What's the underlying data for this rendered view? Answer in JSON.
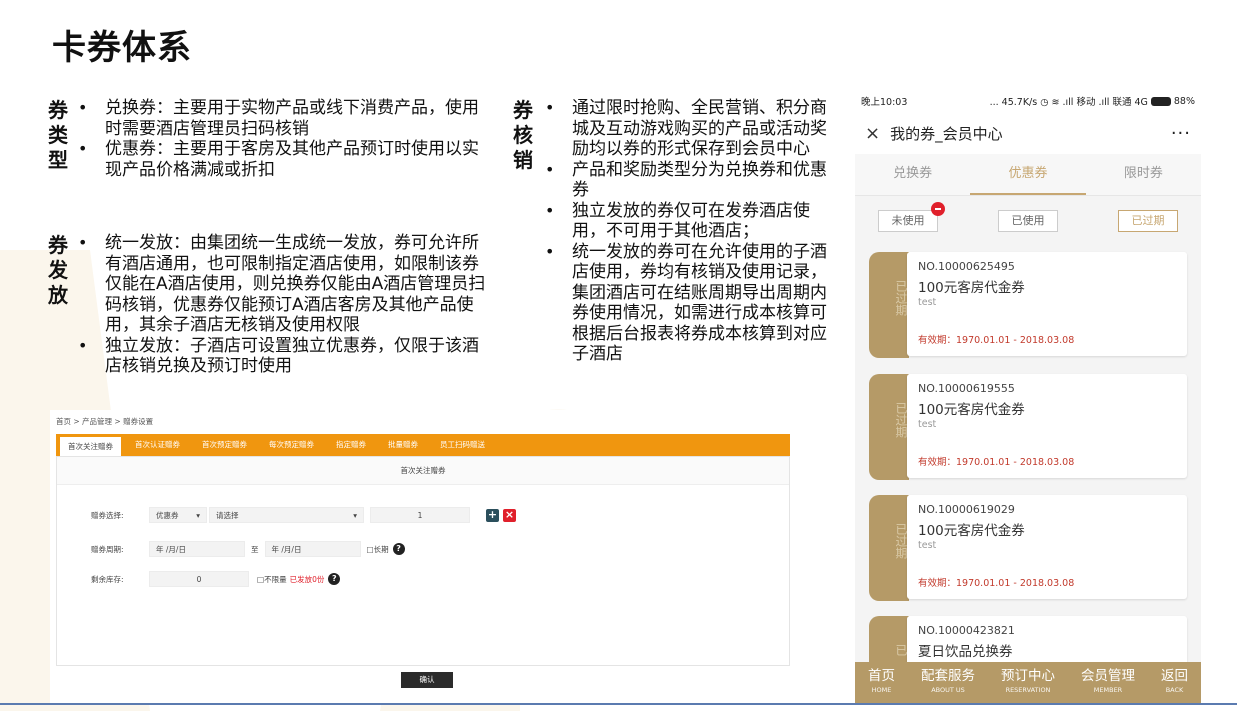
{
  "slide": {
    "title": "卡券体系",
    "types_label": "券类型",
    "types": [
      "兑换券：主要用于实物产品或线下消费产品，使用时需要酒店管理员扫码核销",
      "优惠券：主要用于客房及其他产品预订时使用以实现产品价格满减或折扣"
    ],
    "issue_label": "券发放",
    "issue": [
      "统一发放：由集团统一生成统一发放，券可允许所有酒店通用，也可限制指定酒店使用，如限制该券仅能在A酒店使用，则兑换券仅能由A酒店管理员扫码核销，优惠券仅能预订A酒店客房及其他产品使用，其余子酒店无核销及使用权限",
      "独立发放：子酒店可设置独立优惠券，仅限于该酒店核销兑换及预订时使用"
    ],
    "verify_label": "券核销",
    "verify": [
      "通过限时抢购、全民营销、积分商城及互动游戏购买的产品或活动奖励均以券的形式保存到会员中心",
      "产品和奖励类型分为兑换券和优惠券",
      "独立发放的券仅可在发券酒店使用，不可用于其他酒店；",
      "统一发放的券可在允许使用的子酒店使用，券均有核销及使用记录，集团酒店可在结账周期导出周期内券使用情况，如需进行成本核算可根据后台报表将券成本核算到对应子酒店"
    ]
  },
  "admin": {
    "breadcrumb": "首页 > 产品管理 > 赠券设置",
    "tabs": [
      "首次关注赠券",
      "首次认证赠券",
      "首次预定赠券",
      "每次预定赠券",
      "指定赠券",
      "批量赠券",
      "员工扫码赠送"
    ],
    "panel_title": "首次关注赠券",
    "row1_label": "赠券选择:",
    "coupon_type": "优惠券",
    "coupon_select": "请选择",
    "quantity": "1",
    "add_btn": "+",
    "del_btn": "×",
    "row2_label": "赠券周期:",
    "date_from": "年 /月/日",
    "to_label": "至",
    "date_to": "年 /月/日",
    "longterm": "□长期",
    "help": "?",
    "row3_label": "剩余库存:",
    "stock": "0",
    "unlimited": "□不限量",
    "issued": "已发放0份",
    "confirm": "确认"
  },
  "phone": {
    "time": "晚上10:03",
    "status_right": "... 45.7K/s  ◷ ≋ .ıll 移动 .ıll 联通 4G",
    "battery": "88%",
    "title": "我的券_会员中心",
    "close_icon": "×",
    "more_icon": "···",
    "tabs": [
      "兑换券",
      "优惠券",
      "限时券"
    ],
    "active_tab": 1,
    "filters": [
      "未使用",
      "已使用",
      "已过期"
    ],
    "coupons": [
      {
        "no": "NO.10000625495",
        "name": "100元客房代金券",
        "desc": "test",
        "valid": "有效期：1970.01.01 - 2018.03.08",
        "stub": "已过期"
      },
      {
        "no": "NO.10000619555",
        "name": "100元客房代金券",
        "desc": "test",
        "valid": "有效期：1970.01.01 - 2018.03.08",
        "stub": "已过期"
      },
      {
        "no": "NO.10000619029",
        "name": "100元客房代金券",
        "desc": "test",
        "valid": "有效期：1970.01.01 - 2018.03.08",
        "stub": "已过期"
      },
      {
        "no": "NO.10000423821",
        "name": "夏日饮品兑换券",
        "desc": "",
        "valid": "",
        "stub": "已"
      }
    ],
    "nav": [
      {
        "cn": "首页",
        "en": "HOME"
      },
      {
        "cn": "配套服务",
        "en": "ABOUT US"
      },
      {
        "cn": "预订中心",
        "en": "RESERVATION"
      },
      {
        "cn": "会员管理",
        "en": "MEMBER"
      },
      {
        "cn": "返回",
        "en": "BACK"
      }
    ]
  },
  "colors": {
    "accent_orange": "#f0960f",
    "gold": "#b59a67",
    "red": "#c23a2c"
  }
}
